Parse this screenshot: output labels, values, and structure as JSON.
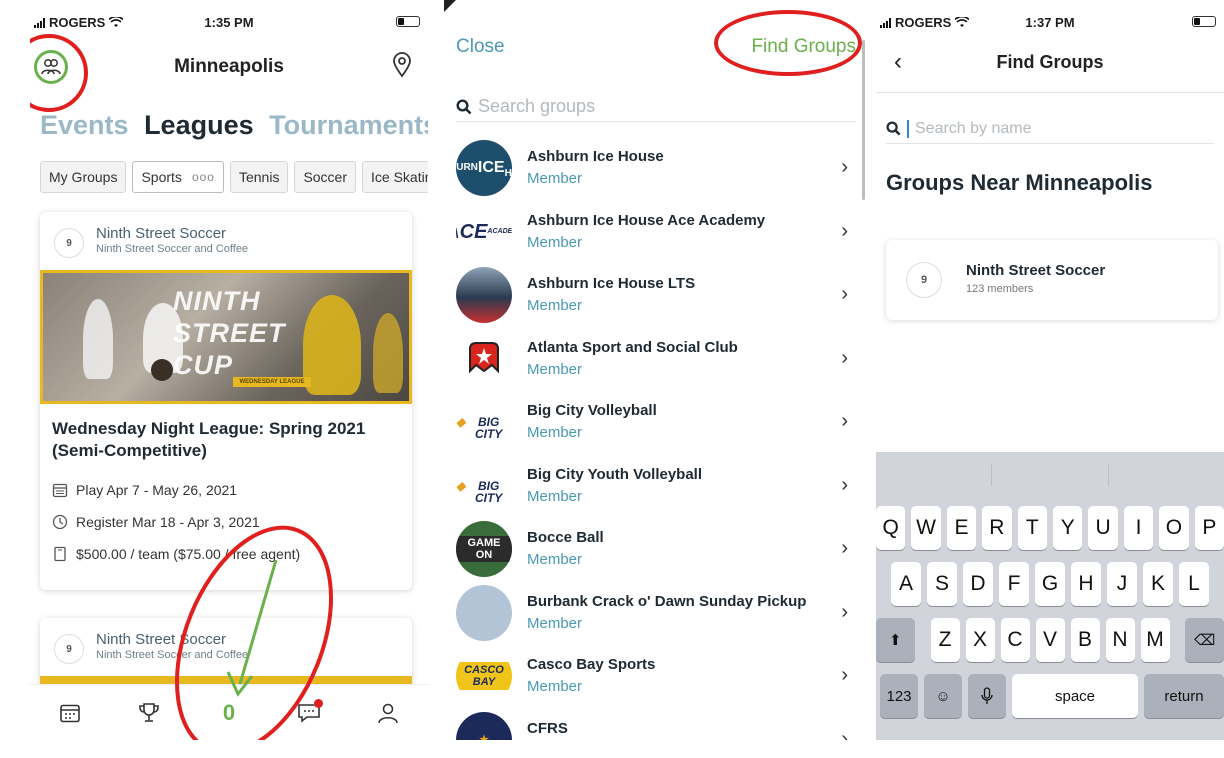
{
  "panel1": {
    "status": {
      "carrier": "ROGERS",
      "time": "1:35 PM"
    },
    "header": {
      "city": "Minneapolis",
      "group_icon": "people-group-icon",
      "pin_icon": "location-pin-icon"
    },
    "tabs": [
      "Events",
      "Leagues",
      "Tournaments"
    ],
    "active_tab": "Leagues",
    "chips": [
      "My Groups",
      "Sports",
      "Tennis",
      "Soccer",
      "Ice Skating"
    ],
    "card": {
      "org_name": "Ninth Street Soccer",
      "org_sub": "Ninth Street Soccer and Coffee",
      "banner_text": "NINTH STREET CUP",
      "banner_tag": "WEDNESDAY LEAGUE",
      "title": "Wednesday Night League: Spring 2021 (Semi-Competitive)",
      "play": "Play Apr 7 - May 26, 2021",
      "register": "Register Mar 18 - Apr 3, 2021",
      "price": "$500.00 / team  ($75.00 / free agent)"
    },
    "card2": {
      "org_name": "Ninth Street Soccer",
      "org_sub": "Ninth Street Soccer and Coffee"
    },
    "bottom_nav": {
      "items": [
        "calendar-icon",
        "trophy-icon",
        "groups-counter",
        "chat-icon",
        "profile-icon"
      ],
      "counter": "0"
    },
    "colors": {
      "accent_green": "#6ab04c",
      "annotation_red": "#e0201f",
      "accent_blue": "#4b99b6"
    }
  },
  "panel2": {
    "close": "Close",
    "find_groups": "Find Groups",
    "search_placeholder": "Search groups",
    "groups": [
      {
        "name": "Ashburn Ice House",
        "sub": "Member",
        "logo": "ASHBURN ICE HOUSE"
      },
      {
        "name": "Ashburn Ice House Ace Academy",
        "sub": "Member",
        "logo": "ACE ACADEMY"
      },
      {
        "name": "Ashburn Ice House LTS",
        "sub": "Member",
        "logo": ""
      },
      {
        "name": "Atlanta Sport and Social Club",
        "sub": "Member",
        "logo": ""
      },
      {
        "name": "Big City Volleyball",
        "sub": "Member",
        "logo": "BIG CITY"
      },
      {
        "name": "Big City Youth Volleyball",
        "sub": "Member",
        "logo": "BIG CITY"
      },
      {
        "name": "Bocce Ball",
        "sub": "Member",
        "logo": "GAME ON"
      },
      {
        "name": "Burbank Crack o' Dawn Sunday Pickup",
        "sub": "Member",
        "logo": ""
      },
      {
        "name": "Casco Bay Sports",
        "sub": "Member",
        "logo": "CASCO BAY SPORTS"
      },
      {
        "name": "CFRS",
        "sub": "",
        "logo": ""
      }
    ]
  },
  "panel3": {
    "status": {
      "carrier": "ROGERS",
      "time": "1:37 PM"
    },
    "title": "Find Groups",
    "search_placeholder": "Search by name",
    "section": "Groups Near Minneapolis",
    "result": {
      "name": "Ninth Street Soccer",
      "members": "123 members"
    },
    "keyboard": {
      "row1": [
        "Q",
        "W",
        "E",
        "R",
        "T",
        "Y",
        "U",
        "I",
        "O",
        "P"
      ],
      "row2": [
        "A",
        "S",
        "D",
        "F",
        "G",
        "H",
        "J",
        "K",
        "L"
      ],
      "row3": [
        "Z",
        "X",
        "C",
        "V",
        "B",
        "N",
        "M"
      ],
      "numbers": "123",
      "space": "space",
      "return": "return"
    }
  }
}
